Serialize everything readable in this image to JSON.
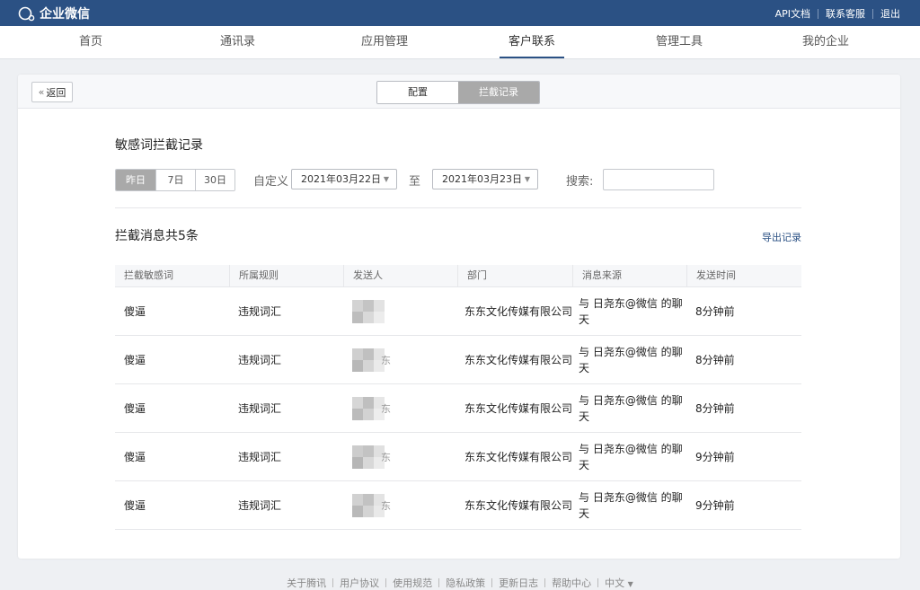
{
  "app": {
    "logo_text": "企业微信"
  },
  "top_links": [
    "API文档",
    "联系客服",
    "退出"
  ],
  "nav": [
    "首页",
    "通讯录",
    "应用管理",
    "客户联系",
    "管理工具",
    "我的企业"
  ],
  "nav_active": 3,
  "card_head": {
    "back_label": "返回",
    "tabs": [
      "配置",
      "拦截记录"
    ],
    "active_tab": 1
  },
  "section_title": "敏感词拦截记录",
  "filter": {
    "periods": [
      "昨日",
      "7日",
      "30日"
    ],
    "custom_label": "自定义",
    "start_date": "2021年03月22日",
    "to_label": "至",
    "end_date": "2021年03月23日",
    "search_label": "搜索:",
    "search_value": ""
  },
  "count_text": "拦截消息共5条",
  "export_label": "导出记录",
  "table": {
    "headers": [
      "拦截敏感词",
      "所属规则",
      "发送人",
      "部门",
      "消息来源",
      "发送时间"
    ],
    "rows": [
      {
        "word": "傻逼",
        "rule": "违规词汇",
        "sender_tail": "",
        "dept": "东东文化传媒有限公司",
        "source": "与 日尧东@微信 的聊天",
        "time": "8分钟前"
      },
      {
        "word": "傻逼",
        "rule": "违规词汇",
        "sender_tail": "东",
        "dept": "东东文化传媒有限公司",
        "source": "与 日尧东@微信 的聊天",
        "time": "8分钟前"
      },
      {
        "word": "傻逼",
        "rule": "违规词汇",
        "sender_tail": "东",
        "dept": "东东文化传媒有限公司",
        "source": "与 日尧东@微信 的聊天",
        "time": "8分钟前"
      },
      {
        "word": "傻逼",
        "rule": "违规词汇",
        "sender_tail": "东",
        "dept": "东东文化传媒有限公司",
        "source": "与 日尧东@微信 的聊天",
        "time": "9分钟前"
      },
      {
        "word": "傻逼",
        "rule": "违规词汇",
        "sender_tail": "东",
        "dept": "东东文化传媒有限公司",
        "source": "与 日尧东@微信 的聊天",
        "time": "9分钟前"
      }
    ]
  },
  "footer_links": [
    "关于腾讯",
    "用户协议",
    "使用规范",
    "隐私政策",
    "更新日志",
    "帮助中心",
    "中文"
  ],
  "colors": {
    "brand": "#2b5184",
    "tab_active": "#a9a9a9"
  }
}
